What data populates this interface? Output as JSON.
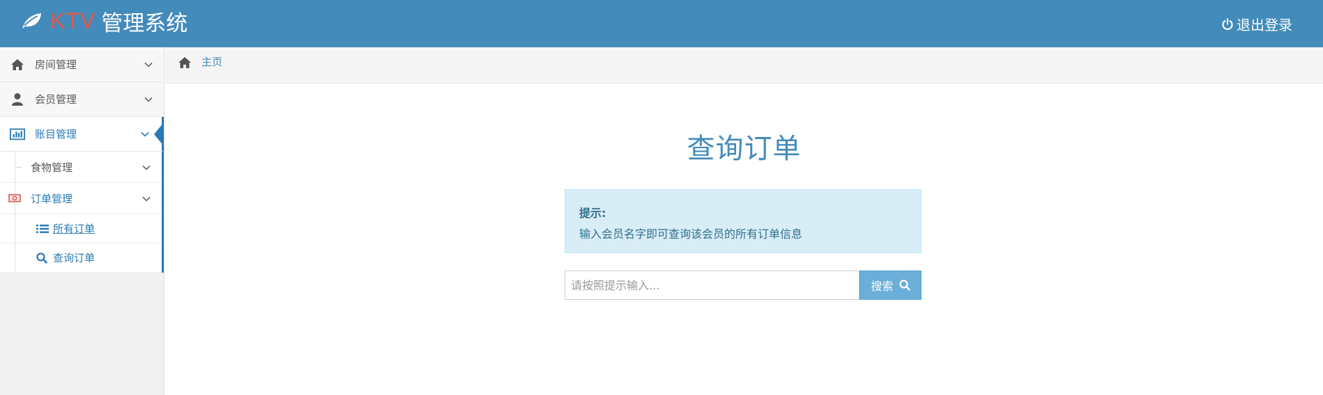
{
  "header": {
    "brand_prefix": "KTV",
    "brand_suffix": "管理系统",
    "logout_label": "退出登录",
    "colors": {
      "bar": "#428bba",
      "brand_prefix": "#e8574a"
    }
  },
  "sidebar": {
    "items": [
      {
        "label": "房间管理",
        "icon": "home-icon"
      },
      {
        "label": "会员管理",
        "icon": "user-icon"
      },
      {
        "label": "账目管理",
        "icon": "bar-chart-icon",
        "active": true
      }
    ],
    "sub_items": [
      {
        "label": "食物管理"
      },
      {
        "label": "订单管理",
        "icon": "money-icon",
        "open": true
      }
    ],
    "order_children": [
      {
        "label": "所有订单",
        "icon": "list-icon"
      },
      {
        "label": "查询订单",
        "icon": "search-icon"
      }
    ]
  },
  "breadcrumb": {
    "home_icon": "home-icon",
    "current": "主页"
  },
  "main": {
    "title": "查询订单",
    "alert": {
      "title": "提示:",
      "message": "输入会员名字即可查询该会员的所有订单信息"
    },
    "search": {
      "placeholder": "请按照提示输入...",
      "button_label": "搜索"
    }
  }
}
